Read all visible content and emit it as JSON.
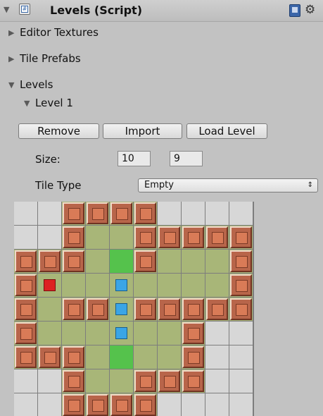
{
  "header": {
    "title": "Levels (Script)",
    "icons": [
      "foldout-arrow",
      "script-checkbox",
      "help-book-icon",
      "gear-icon"
    ]
  },
  "sections": {
    "editor_textures": "Editor Textures",
    "tile_prefabs": "Tile Prefabs",
    "levels": "Levels",
    "level1": "Level 1"
  },
  "buttons": {
    "remove": "Remove",
    "import": "Import",
    "load_level": "Load Level"
  },
  "size": {
    "label": "Size:",
    "width": "10",
    "height": "9"
  },
  "tile_type": {
    "label": "Tile Type",
    "selected": "Empty",
    "arrows": "⇕"
  },
  "tile_grid": {
    "legend": {
      "E": "empty",
      "F": "floor",
      "W": "wall",
      "G": "goal",
      "P": "player",
      "B": "box"
    },
    "rows": [
      "EEWWWWEEEE",
      "EEWFFWWWWW",
      "WWWFGWFFFW",
      "WPFFBFFFFW",
      "WFWWBWWWWW",
      "WFFFBFFWEE",
      "WWWFGFFWEE",
      "EEWFFWWWEE",
      "EEWWWWEEEE"
    ]
  },
  "colors": {
    "panel_bg": "#c2c2c2",
    "floor": "#a8b678",
    "goal": "#55c24c",
    "wall": "#b8654a",
    "player": "#dd2222",
    "box": "#3aa5e6"
  }
}
